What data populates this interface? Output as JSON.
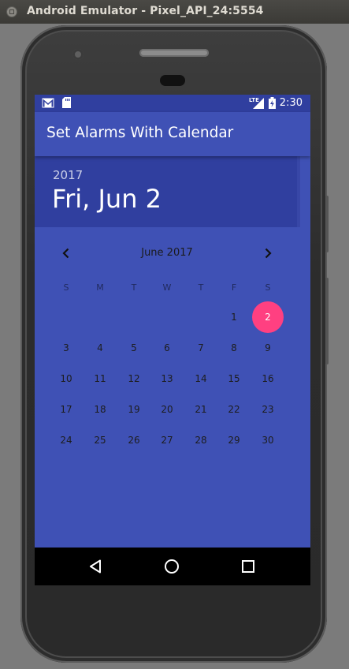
{
  "window": {
    "title": "Android Emulator - Pixel_API_24:5554",
    "close_icon": "close-window-icon"
  },
  "status_bar": {
    "time": "2:30",
    "network_label": "LTE",
    "icons": [
      "gmail-notification-icon",
      "sd-card-icon",
      "lte-signal-icon",
      "battery-charging-icon"
    ]
  },
  "app": {
    "title": "Set Alarms With Calendar"
  },
  "date_picker": {
    "year": "2017",
    "selected_date": "Fri, Jun 2",
    "month_label": "June 2017",
    "weekdays": [
      "S",
      "M",
      "T",
      "W",
      "T",
      "F",
      "S"
    ],
    "first_weekday_index": 4,
    "days_in_month": 30,
    "selected_day": 2,
    "colors": {
      "primary": "#3f51b5",
      "primary_dark": "#303f9f",
      "accent": "#ff4081"
    }
  },
  "nav_bar": {
    "icons": [
      "back-icon",
      "home-icon",
      "recents-icon"
    ]
  }
}
